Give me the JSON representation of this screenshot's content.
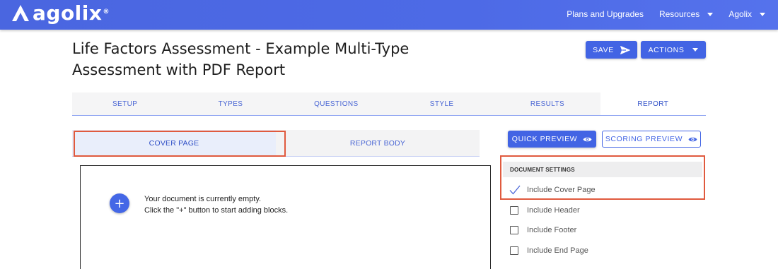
{
  "navbar": {
    "logo_text": "agolix",
    "logo_reg": "®",
    "links": {
      "plans": "Plans and Upgrades",
      "resources": "Resources",
      "account": "Agolix"
    }
  },
  "page": {
    "title_line1": "Life Factors Assessment - Example Multi-Type",
    "title_line2": "Assessment with PDF Report"
  },
  "toolbar": {
    "save_label": "SAVE",
    "actions_label": "ACTIONS"
  },
  "tabs": [
    {
      "label": "SETUP"
    },
    {
      "label": "TYPES"
    },
    {
      "label": "QUESTIONS"
    },
    {
      "label": "STYLE"
    },
    {
      "label": "RESULTS"
    },
    {
      "label": "REPORT",
      "active": true
    }
  ],
  "subtabs": [
    {
      "label": "COVER PAGE",
      "active": true
    },
    {
      "label": "REPORT BODY"
    }
  ],
  "editor": {
    "add_symbol": "+",
    "empty_line1": "Your document is currently empty.",
    "empty_line2": "Click the \"+\" button to start adding blocks."
  },
  "preview": {
    "quick_label": "QUICK PREVIEW",
    "scoring_label": "SCORING PREVIEW"
  },
  "document_settings": {
    "heading": "DOCUMENT SETTINGS",
    "items": [
      {
        "label": "Include Cover Page",
        "checked": true
      },
      {
        "label": "Include Header",
        "checked": false
      },
      {
        "label": "Include Footer",
        "checked": false
      },
      {
        "label": "Include End Page",
        "checked": false
      }
    ]
  },
  "colors": {
    "navbar": "#4d6ae6",
    "primary": "#4264e4",
    "highlight": "#e05a3e"
  },
  "icons": {
    "logo": "agolix-mountain-logo",
    "save": "send-icon",
    "dropdown": "caret-down-icon",
    "preview": "eye-icon",
    "add": "plus-icon",
    "checked": "check-icon"
  }
}
